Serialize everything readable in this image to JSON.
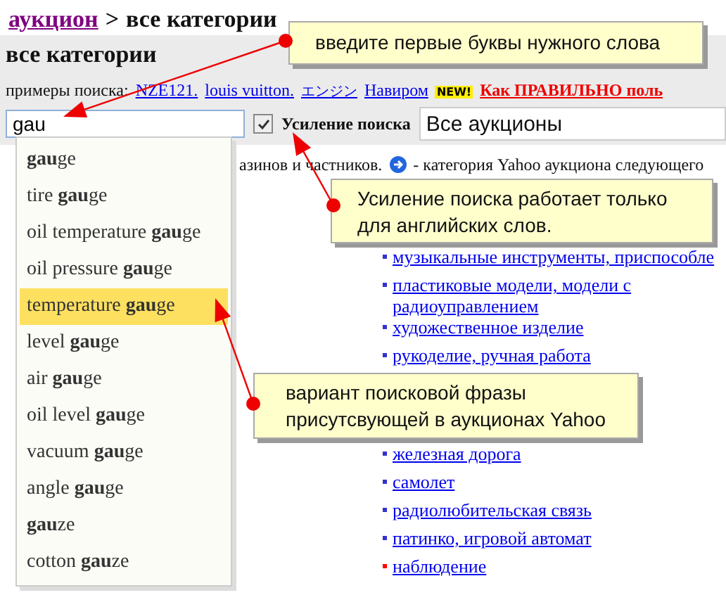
{
  "breadcrumb": {
    "link": "аукцион",
    "separator": ">",
    "current": "все категории"
  },
  "section_title": "все категории",
  "examples": {
    "label": "примеры поиска:",
    "links": [
      "NZE121.",
      "louis vuitton.",
      "エンジン",
      "Навиром"
    ],
    "badge": "NEW!",
    "promo": "Как ПРАВИЛЬНО поль"
  },
  "search": {
    "value": "gau",
    "boost_checked": true,
    "boost_label": "Усиление поиска",
    "scope": "Все аукционы"
  },
  "intro": {
    "text": "азинов и частников.",
    "tail": "- категория Yahoo аукциона следующего"
  },
  "suggestions": [
    {
      "text": "**gau**ge",
      "selected": false
    },
    {
      "text": "tire **gau**ge",
      "selected": false
    },
    {
      "text": "oil temperature **gau**ge",
      "selected": false
    },
    {
      "text": "oil pressure **gau**ge",
      "selected": false
    },
    {
      "text": "temperature **gau**ge",
      "selected": true
    },
    {
      "text": "level **gau**ge",
      "selected": false
    },
    {
      "text": "air **gau**ge",
      "selected": false
    },
    {
      "text": "oil level **gau**ge",
      "selected": false
    },
    {
      "text": "vacuum **gau**ge",
      "selected": false
    },
    {
      "text": "angle **gau**ge",
      "selected": false
    },
    {
      "text": "**gau**ze",
      "selected": false
    },
    {
      "text": "cotton **gau**ze",
      "selected": false
    }
  ],
  "categories": [
    {
      "text": "музыкальные инструменты, приспособле",
      "color": "#3333cc"
    },
    {
      "text": "пластиковые модели, модели с радиоуправлением",
      "color": "#3333cc"
    },
    {
      "text": "художественное изделие",
      "color": "#3333cc"
    },
    {
      "text": "рукоделие, ручная работа",
      "color": "#3333cc"
    },
    {
      "text": "железная дорога",
      "color": "#3333cc"
    },
    {
      "text": "самолет",
      "color": "#3333cc"
    },
    {
      "text": "радиолюбительская связь",
      "color": "#3333cc"
    },
    {
      "text": "патинко, игровой автомат",
      "color": "#3333cc"
    },
    {
      "text": "наблюдение",
      "color": "#ff0000"
    }
  ],
  "callouts": [
    {
      "text": "введите первые буквы нужного слова"
    },
    {
      "text": "Усиление поиска работает только для английских слов."
    },
    {
      "text": "вариант поисковой фразы присутсвующей в аукционах Yahoo"
    }
  ]
}
